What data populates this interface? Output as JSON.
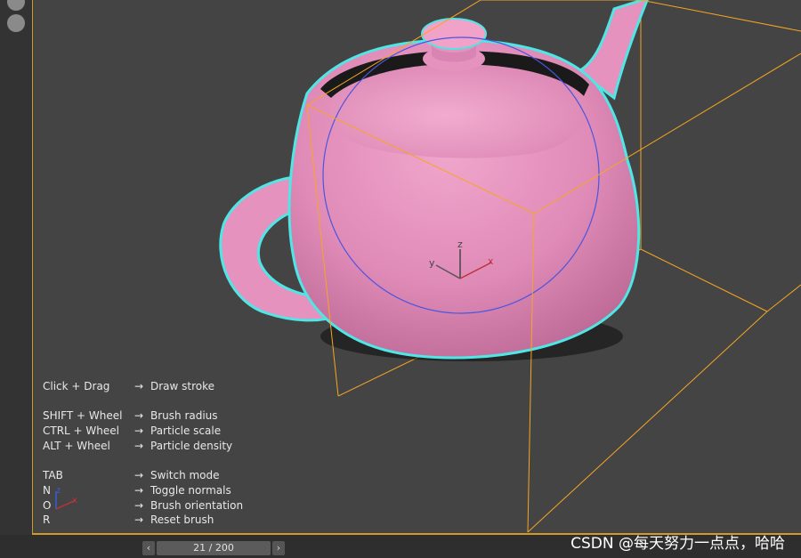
{
  "hotkeys": [
    {
      "key": "Click + Drag",
      "desc": "Draw stroke"
    },
    {
      "key": "SHIFT + Wheel",
      "desc": "Brush radius"
    },
    {
      "key": "CTRL + Wheel",
      "desc": "Particle scale"
    },
    {
      "key": "ALT + Wheel",
      "desc": "Particle density"
    },
    {
      "key": "TAB",
      "desc": "Switch mode"
    },
    {
      "key": "N",
      "desc": "Toggle normals"
    },
    {
      "key": "O",
      "desc": "Brush orientation"
    },
    {
      "key": "R",
      "desc": "Reset brush"
    }
  ],
  "arrow": "→",
  "gizmo": {
    "x": "x",
    "y": "y",
    "z": "z"
  },
  "mini_gizmo": {
    "z": "z",
    "x": "x"
  },
  "timeline": {
    "frame_label": "21 / 200",
    "current_frame": 21,
    "total_frames": 200,
    "prev": "‹",
    "next": "›"
  },
  "watermark": "CSDN @每天努力一点点，哈哈",
  "colors": {
    "teapot": "#e592be",
    "selection_outline": "#4fe6e6",
    "bounding_box": "#f5a623",
    "brush_circle": "#4a55e0",
    "viewport_bg": "#444444"
  }
}
